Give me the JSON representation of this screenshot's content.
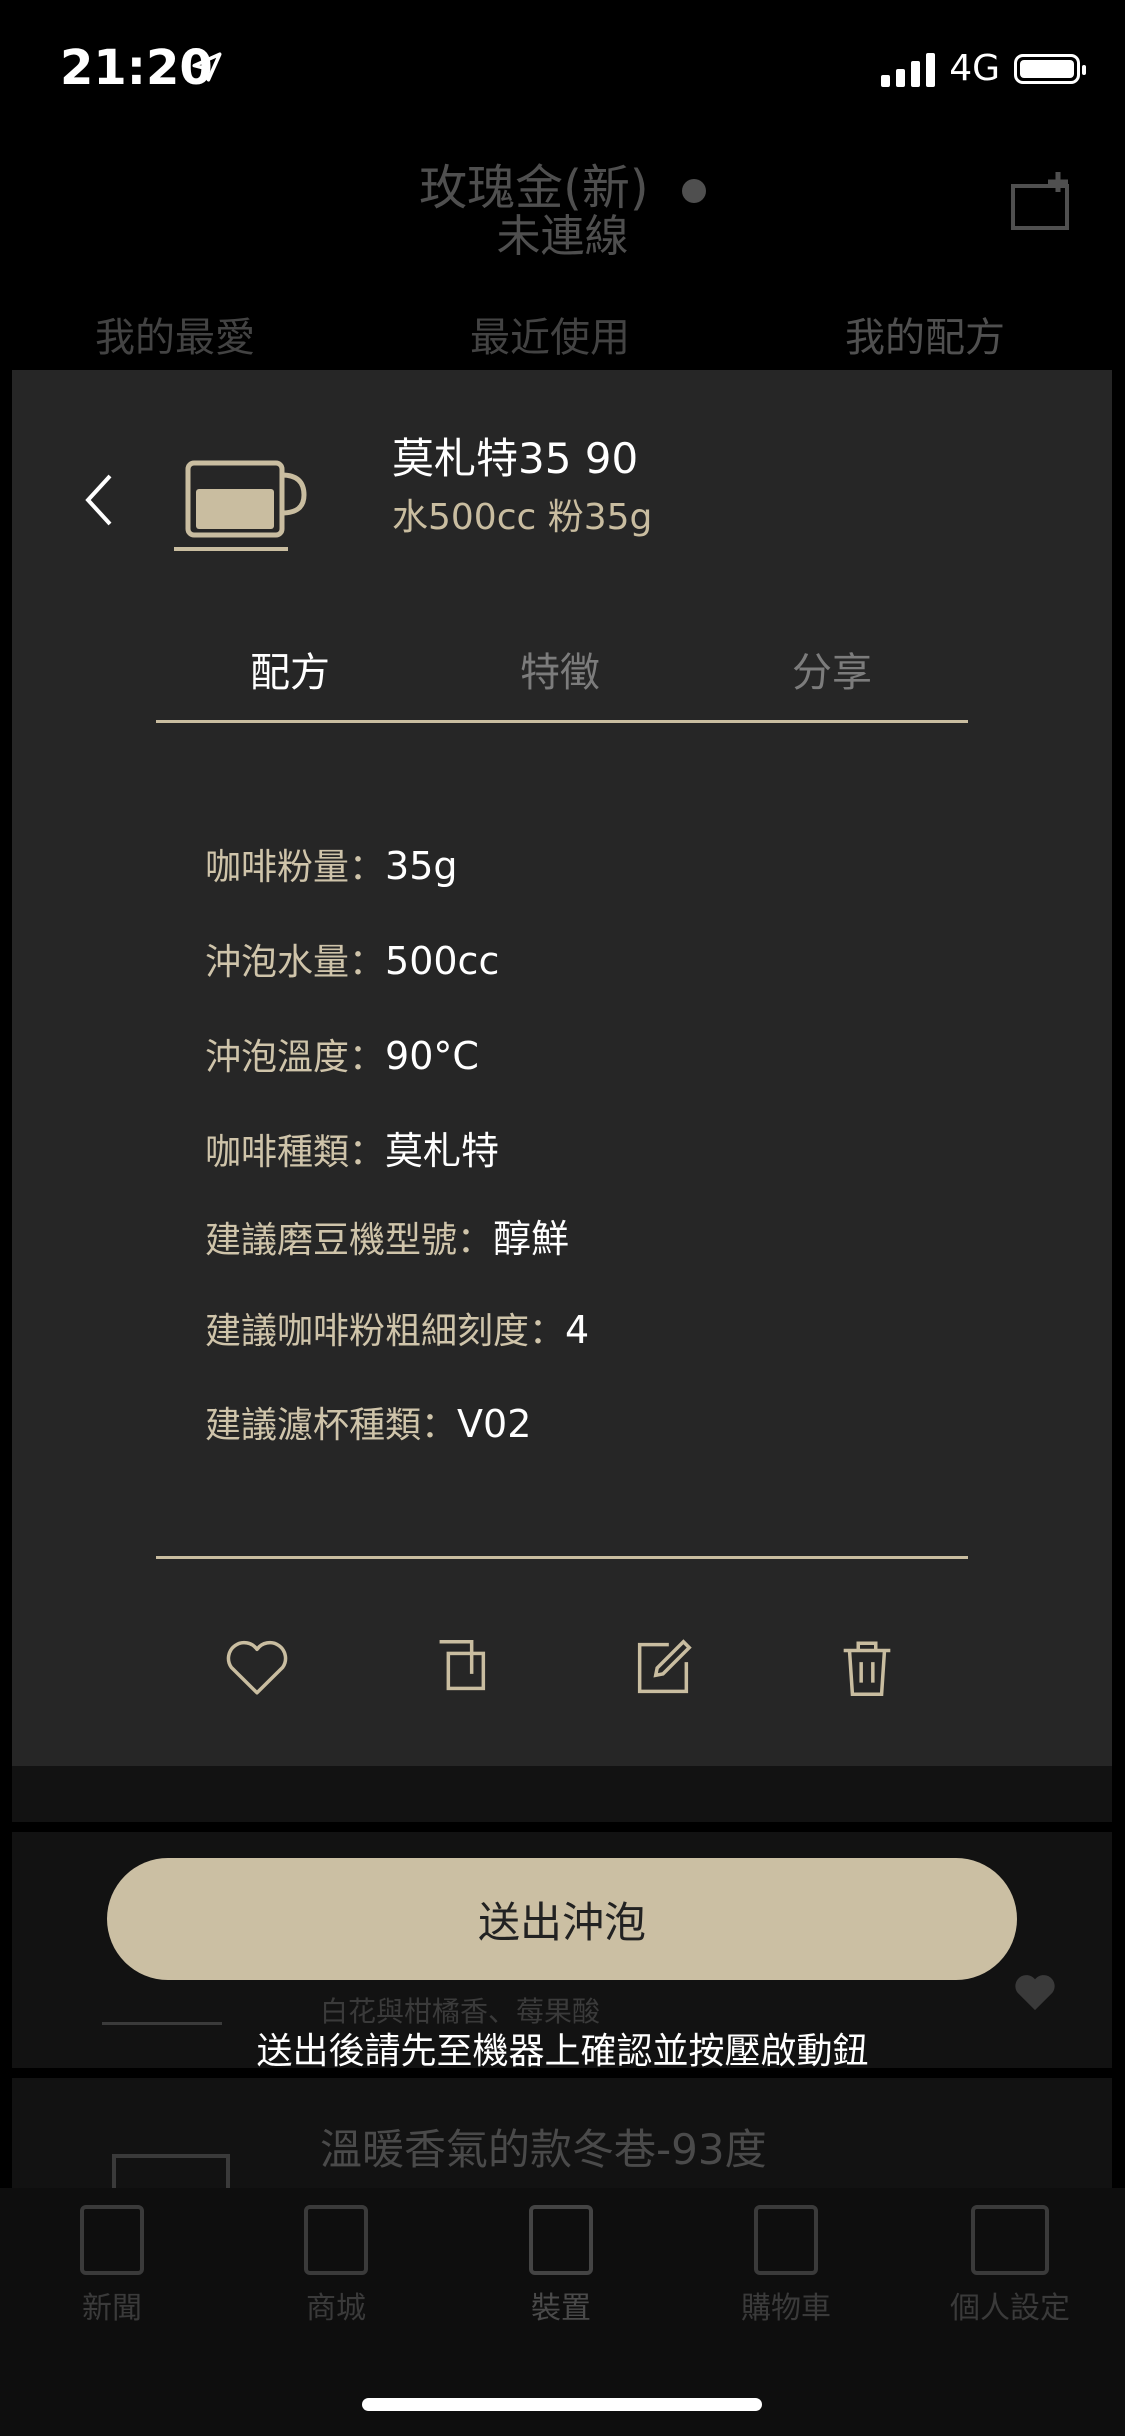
{
  "status": {
    "time": "21:20",
    "network": "4G"
  },
  "header": {
    "device_name": "玫瑰金(新)",
    "device_status": "未連線"
  },
  "background_tabs": [
    "我的最愛",
    "最近使用",
    "我的配方"
  ],
  "background_list": {
    "item_subtitle": "白花與柑橘香、莓果酸",
    "item_title": "溫暖香氣的款冬巷-93度"
  },
  "recipe": {
    "name": "莫札特35 90",
    "summary": "水500cc 粉35g"
  },
  "modal_tabs": [
    "配方",
    "特徵",
    "分享"
  ],
  "details": [
    {
      "label": "咖啡粉量：",
      "value": "35g"
    },
    {
      "label": "沖泡水量：",
      "value": "500cc"
    },
    {
      "label": "沖泡溫度：",
      "value": "90°C"
    },
    {
      "label": "咖啡種類：",
      "value": "莫札特"
    },
    {
      "label": "建議磨豆機型號：",
      "value": "醇鮮"
    },
    {
      "label": "建議咖啡粉粗細刻度：",
      "value": "4"
    },
    {
      "label": "建議濾杯種類：",
      "value": "V02"
    }
  ],
  "actions": [
    "heart-icon",
    "copy-icon",
    "edit-icon",
    "trash-icon"
  ],
  "brew_button": "送出沖泡",
  "brew_note": "送出後請先至機器上確認並按壓啟動鈕",
  "bottom_nav": [
    "新聞",
    "商城",
    "裝置",
    "購物車",
    "個人設定"
  ],
  "colors": {
    "accent": "#cbbfa3",
    "modal_bg": "#262626",
    "gold_text": "#c9bda0"
  }
}
